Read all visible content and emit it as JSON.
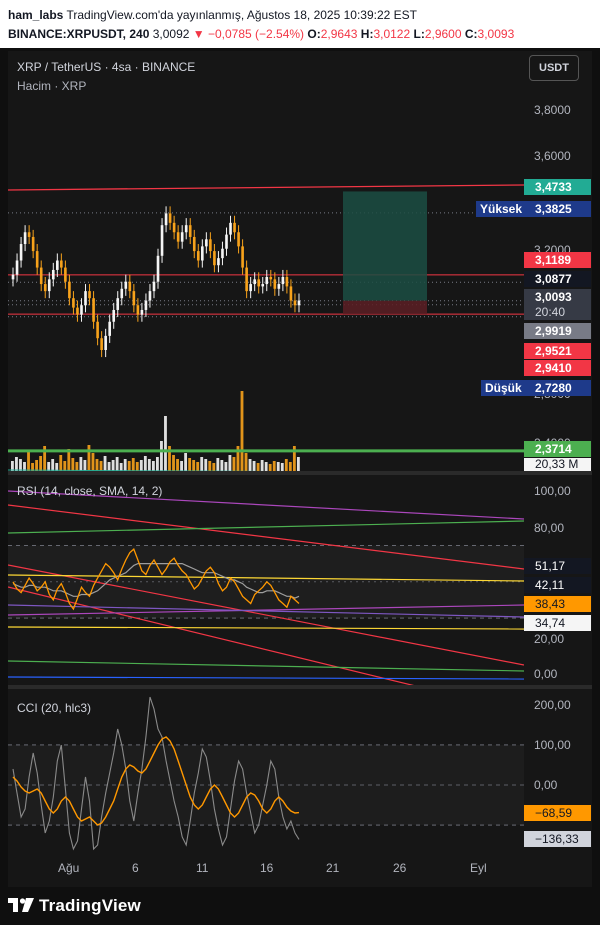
{
  "header": {
    "line1_user": "ham_labs",
    "line1_text": "TradingView.com'da yayınlanmış, Ağustos 18, 2025 10:39:22 EST",
    "symbol": "BINANCE:XRPUSDT, 240",
    "last": "3,0092",
    "change": "▼ −0,0785 (−2.54%)",
    "o_label": "O:",
    "o_val": "2,9643",
    "h_label": "H:",
    "h_val": "3,0122",
    "l_label": "L:",
    "l_val": "2,9600",
    "c_label": "C:",
    "c_val": "3,0093"
  },
  "main": {
    "title": "XRP / TetherUS · 4sa · BINANCE",
    "volume_title": "Hacim · XRP",
    "currency_button": "USDT",
    "high_label": "Yüksek",
    "low_label": "Düşük",
    "axis_ticks": [
      "3,8000",
      "3,6000",
      "3,2000",
      "2,8000",
      "2,4000"
    ],
    "price_labels": {
      "target": "3,4733",
      "high": "3,3825",
      "level_red": "3,1189",
      "level_grey": "3,0877",
      "last": "3,0093",
      "countdown": "20:40",
      "level_2": "2,9919",
      "stop": "2,9521",
      "level_3": "2,9410",
      "low": "2,7280",
      "support": "2,3714",
      "volume": "20,33 M"
    }
  },
  "rsi": {
    "title": "RSI (14, close, SMA, 14, 2)",
    "axis_ticks": [
      "100,00",
      "80,00",
      "20,00",
      "0,00"
    ],
    "labels": {
      "a": "51,17",
      "b": "42,11",
      "rsi": "38,43",
      "c": "34,74"
    }
  },
  "cci": {
    "title": "CCI (20, hlc3)",
    "axis_ticks": [
      "200,00",
      "100,00",
      "0,00"
    ],
    "labels": {
      "sma": "−68,59",
      "cci": "−136,33"
    }
  },
  "xaxis": [
    "Ağu",
    "6",
    "11",
    "16",
    "21",
    "26",
    "Eyl"
  ],
  "footer": {
    "brand": "TradingView"
  },
  "colors": {
    "up": "#f5f5f5",
    "down": "#f7a21b",
    "red": "#f23645",
    "green": "#4caf50",
    "navy": "#1e3a8a",
    "orange": "#ff9800"
  },
  "series": {
    "price_close": [
      3.12,
      3.18,
      3.25,
      3.3,
      3.28,
      3.22,
      3.15,
      3.08,
      3.05,
      3.1,
      3.14,
      3.18,
      3.15,
      3.09,
      3.02,
      2.98,
      2.95,
      2.99,
      3.05,
      3.02,
      2.92,
      2.85,
      2.8,
      2.86,
      2.92,
      2.97,
      3.02,
      3.06,
      3.09,
      3.05,
      2.99,
      2.95,
      2.97,
      3.01,
      3.05,
      3.09,
      3.2,
      3.33,
      3.38,
      3.34,
      3.3,
      3.26,
      3.3,
      3.33,
      3.28,
      3.22,
      3.18,
      3.24,
      3.27,
      3.22,
      3.16,
      3.19,
      3.23,
      3.29,
      3.34,
      3.3,
      3.24,
      3.15,
      3.05,
      3.08,
      3.1,
      3.07,
      3.08,
      3.11,
      3.1,
      3.06,
      3.08,
      3.11,
      3.07,
      3.01,
      2.99,
      3.01
    ],
    "rsi": [
      50,
      46,
      44,
      48,
      52,
      49,
      45,
      47,
      50,
      43,
      40,
      46,
      49,
      44,
      38,
      35,
      41,
      47,
      44,
      42,
      48,
      52,
      56,
      60,
      58,
      55,
      51,
      57,
      62,
      66,
      68,
      62,
      56,
      54,
      59,
      62,
      58,
      54,
      57,
      61,
      63,
      59,
      56,
      54,
      50,
      46,
      48,
      52,
      56,
      58,
      55,
      49,
      45,
      47,
      52,
      50,
      46,
      42,
      40,
      38,
      43,
      45,
      47,
      50,
      48,
      44,
      40,
      38,
      36,
      42,
      40,
      38
    ],
    "rsi_sma": [
      49,
      48,
      47,
      47,
      48,
      48,
      47,
      47,
      47,
      46,
      45,
      45,
      45,
      44,
      43,
      42,
      42,
      43,
      43,
      43,
      44,
      45,
      47,
      49,
      51,
      52,
      53,
      54,
      55,
      57,
      59,
      60,
      60,
      60,
      60,
      60,
      60,
      60,
      60,
      60,
      60,
      60,
      60,
      59,
      58,
      57,
      56,
      55,
      55,
      55,
      55,
      54,
      53,
      52,
      51,
      51,
      50,
      49,
      47,
      46,
      45,
      44,
      44,
      45,
      45,
      45,
      44,
      43,
      42,
      42,
      41,
      42
    ],
    "cci": [
      40,
      -20,
      -80,
      -60,
      20,
      80,
      30,
      -50,
      -120,
      -90,
      -30,
      60,
      100,
      -10,
      -120,
      -160,
      -140,
      -60,
      20,
      -40,
      -160,
      -150,
      -80,
      -20,
      30,
      80,
      140,
      100,
      40,
      -40,
      -90,
      -20,
      40,
      120,
      220,
      190,
      140,
      120,
      60,
      10,
      -40,
      -80,
      -130,
      -150,
      -90,
      -20,
      30,
      90,
      70,
      10,
      -60,
      -110,
      -150,
      -130,
      -60,
      10,
      60,
      40,
      -20,
      -70,
      -120,
      -100,
      -50,
      0,
      60,
      40,
      -30,
      -80,
      -110,
      -90,
      -120,
      -136
    ],
    "cci_sma": [
      20,
      10,
      -5,
      -15,
      -20,
      -15,
      -10,
      -20,
      -40,
      -60,
      -70,
      -60,
      -40,
      -30,
      -40,
      -60,
      -80,
      -90,
      -85,
      -80,
      -90,
      -100,
      -95,
      -80,
      -60,
      -40,
      -10,
      20,
      40,
      50,
      45,
      35,
      30,
      40,
      60,
      80,
      100,
      115,
      120,
      110,
      90,
      60,
      30,
      0,
      -30,
      -50,
      -60,
      -50,
      -30,
      -10,
      0,
      -10,
      -30,
      -50,
      -70,
      -80,
      -70,
      -50,
      -30,
      -20,
      -25,
      -40,
      -60,
      -70,
      -60,
      -40,
      -30,
      -40,
      -55,
      -65,
      -70,
      -69
    ],
    "volume": [
      10,
      14,
      12,
      9,
      20,
      8,
      11,
      15,
      25,
      9,
      12,
      8,
      16,
      10,
      22,
      13,
      9,
      14,
      11,
      26,
      18,
      12,
      10,
      15,
      9,
      11,
      14,
      8,
      12,
      10,
      13,
      9,
      11,
      15,
      12,
      10,
      14,
      30,
      55,
      25,
      16,
      12,
      10,
      18,
      13,
      11,
      9,
      14,
      12,
      10,
      8,
      13,
      11,
      9,
      16,
      14,
      25,
      80,
      18,
      12,
      10,
      8,
      11,
      9,
      7,
      10,
      9,
      8,
      12,
      9,
      25,
      14
    ]
  }
}
